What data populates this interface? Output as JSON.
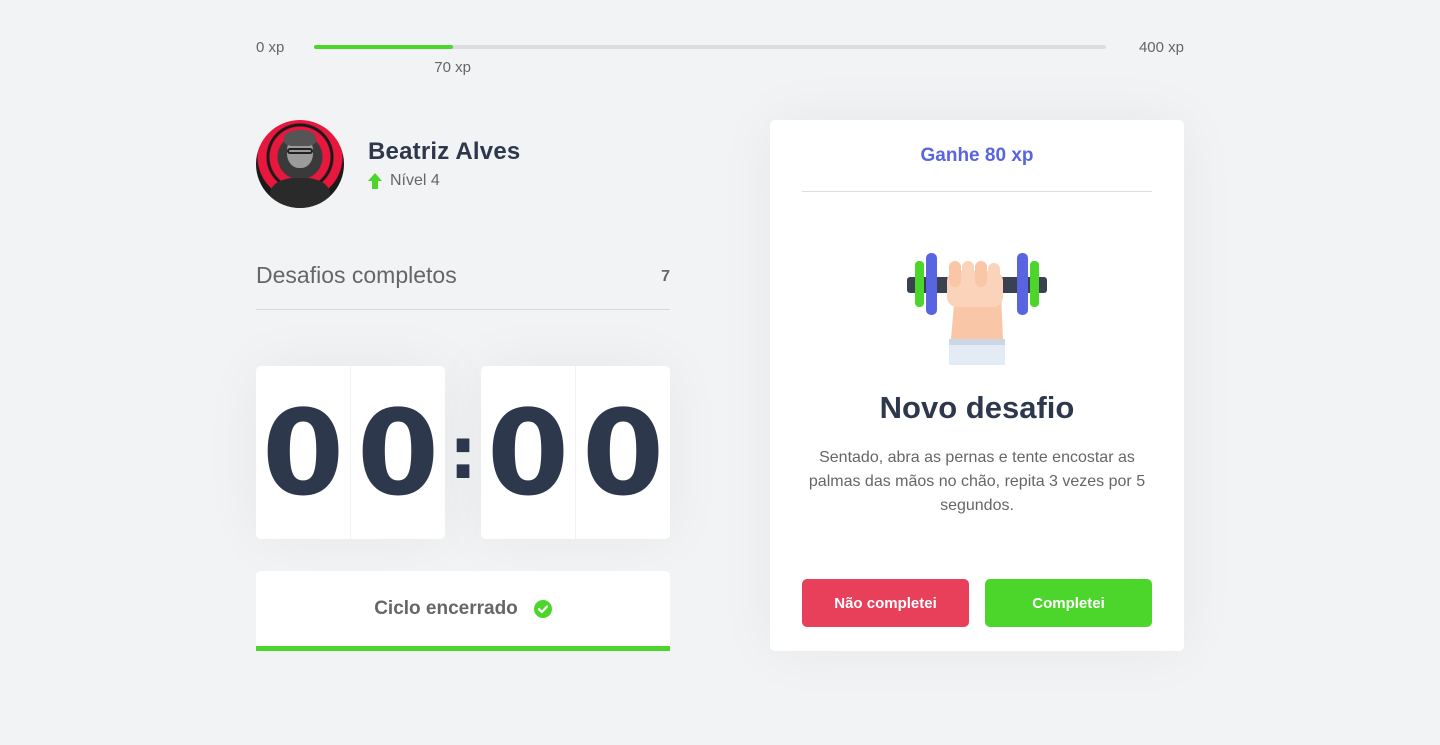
{
  "xp": {
    "min_label": "0 xp",
    "max_label": "400 xp",
    "current_label": "70 xp",
    "current": 70,
    "max": 400
  },
  "profile": {
    "name": "Beatriz Alves",
    "level_label": "Nível 4"
  },
  "completed": {
    "label": "Desafios completos",
    "count": "7"
  },
  "countdown": {
    "minute_left": "0",
    "minute_right": "0",
    "separator": ":",
    "second_left": "0",
    "second_right": "0"
  },
  "cycle": {
    "label": "Ciclo encerrado"
  },
  "challenge": {
    "header": "Ganhe 80 xp",
    "title": "Novo desafio",
    "description": "Sentado, abra as pernas e tente encostar as palmas das mãos no chão, repita 3 vezes por 5 segundos.",
    "fail_label": "Não completei",
    "success_label": "Completei",
    "icon": "dumbbell-icon"
  },
  "colors": {
    "background": "#F2F3F5",
    "green": "#4CD62B",
    "red": "#E83F5B",
    "blue": "#5965E0",
    "title": "#2E384D",
    "text": "#666666"
  }
}
